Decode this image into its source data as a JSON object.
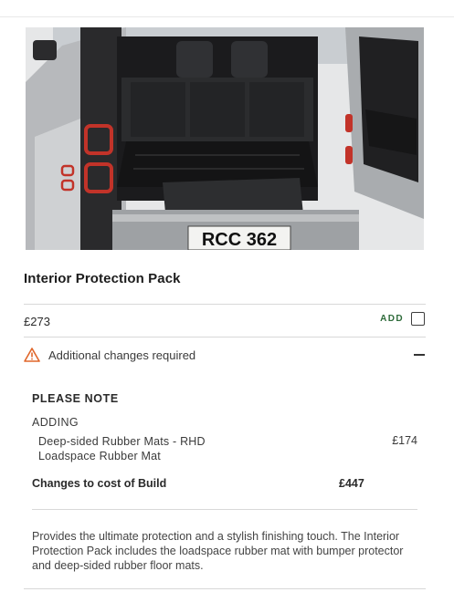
{
  "product": {
    "image_alt": "Vehicle loadspace with rubber mat and bumper protector",
    "plate_text": "RCC 362",
    "title": "Interior Protection Pack",
    "price": "£273",
    "add_label": "ADD",
    "add_checked": false
  },
  "changes": {
    "label": "Additional changes required",
    "expanded": true,
    "note_title": "PLEASE NOTE",
    "section_label": "ADDING",
    "items": [
      "Deep-sided Rubber Mats - RHD",
      "Loadspace Rubber Mat"
    ],
    "items_price": "£174",
    "cost_label": "Changes to cost of Build",
    "cost_value": "£447"
  },
  "description": "Provides the ultimate protection and a stylish finishing touch. The Interior Protection Pack includes the loadspace rubber mat with bumper protector and deep-sided rubber floor mats.",
  "colors": {
    "accent_green": "#2e6b3a",
    "warning_orange": "#e0662a",
    "divider": "#d8d8d8"
  },
  "icons": {
    "warning": "warning-triangle-icon",
    "collapse": "minus-icon",
    "checkbox": "checkbox-icon"
  }
}
